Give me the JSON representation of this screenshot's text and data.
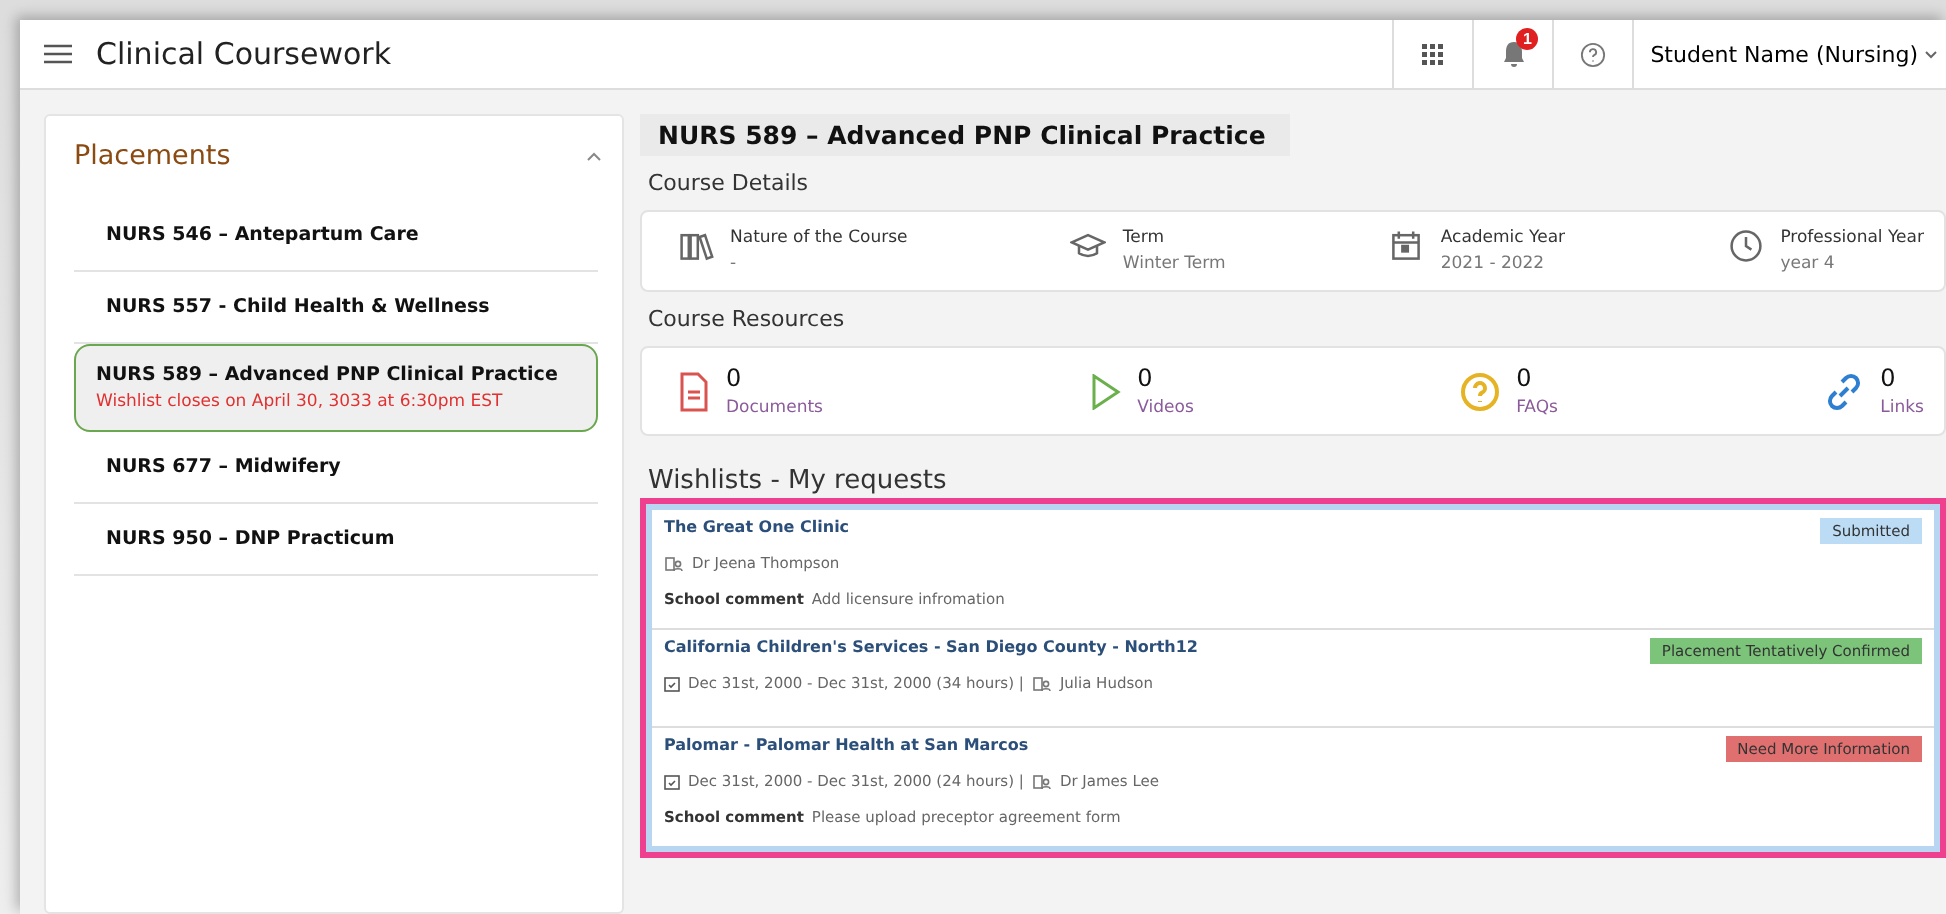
{
  "header": {
    "title": "Clinical Coursework",
    "notification_count": "1",
    "user": "Student Name (Nursing)"
  },
  "sidebar": {
    "title": "Placements",
    "expanded": true,
    "items": [
      {
        "label": "NURS 546 – Antepartum Care",
        "selected": false
      },
      {
        "label": "NURS 557 - Child Health & Wellness",
        "selected": false
      },
      {
        "label": "NURS 589 – Advanced PNP Clinical Practice",
        "selected": true,
        "note": "Wishlist closes on April 30, 3033 at 6:30pm EST"
      },
      {
        "label": "NURS 677 – Midwifery",
        "selected": false
      },
      {
        "label": "NURS 950 – DNP Practicum",
        "selected": false
      }
    ]
  },
  "course": {
    "title": "NURS 589 – Advanced PNP Clinical Practice",
    "details_heading": "Course Details",
    "details": [
      {
        "kind": "books",
        "label": "Nature of the Course",
        "value": "-"
      },
      {
        "kind": "cap",
        "label": "Term",
        "value": "Winter Term"
      },
      {
        "kind": "calendar",
        "label": "Academic Year",
        "value": "2021 - 2022"
      },
      {
        "kind": "clock",
        "label": "Professional Year",
        "value": "year 4"
      }
    ],
    "resources_heading": "Course Resources",
    "resources": [
      {
        "kind": "document",
        "count": "0",
        "label": "Documents"
      },
      {
        "kind": "video",
        "count": "0",
        "label": "Videos"
      },
      {
        "kind": "faq",
        "count": "0",
        "label": "FAQs"
      },
      {
        "kind": "link",
        "count": "0",
        "label": "Links"
      }
    ]
  },
  "wishlists": {
    "heading": "Wishlists - My requests",
    "items": [
      {
        "title": "The Great One Clinic",
        "person": "Dr Jeena Thompson",
        "comment_label": "School comment",
        "comment": "Add licensure infromation",
        "status": "Submitted",
        "color": "#bcdcf5"
      },
      {
        "title": "California Children's Services - San Diego County - North12",
        "dates": "Dec 31st, 2000 - Dec 31st, 2000 (34 hours) |",
        "person": "Julia Hudson",
        "status": "Placement Tentatively Confirmed",
        "color": "#7cc47a"
      },
      {
        "title": "Palomar - Palomar Health at San Marcos",
        "dates": "Dec 31st, 2000 - Dec 31st, 2000 (24 hours) |",
        "person": "Dr James Lee",
        "comment_label": "School comment",
        "comment": "Please upload preceptor agreement form",
        "status": "Need More Information",
        "color": "#e07070"
      }
    ]
  }
}
